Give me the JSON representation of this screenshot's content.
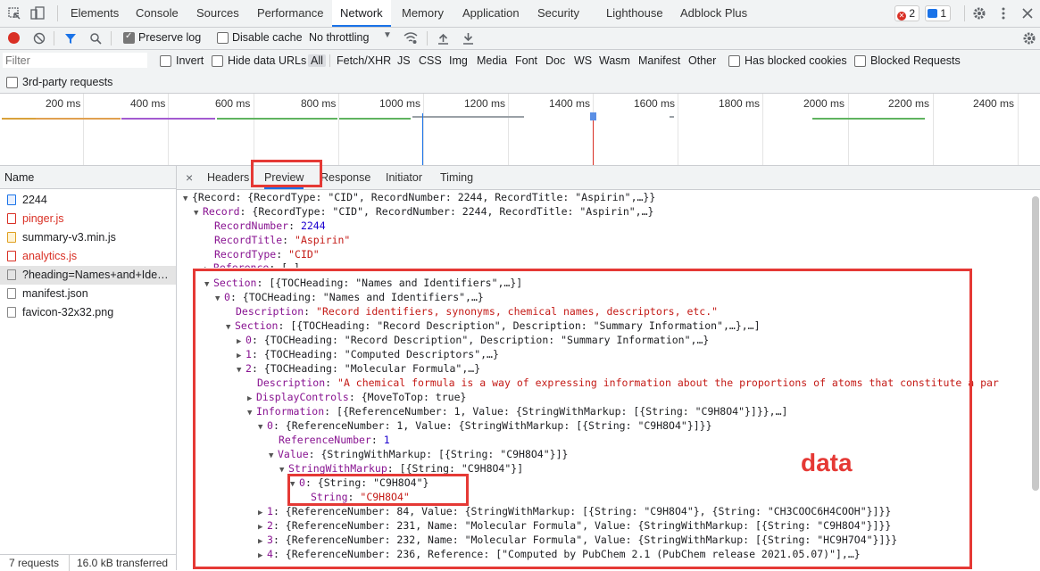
{
  "devtools_tabs": [
    "Elements",
    "Console",
    "Sources",
    "Performance",
    "Network",
    "Memory",
    "Application",
    "Security",
    "Lighthouse",
    "Adblock Plus"
  ],
  "active_tab": "Network",
  "badges": {
    "errors": "2",
    "messages": "1"
  },
  "toolbar": {
    "preserve_log": "Preserve log",
    "disable_cache": "Disable cache",
    "throttling": "No throttling"
  },
  "filter": {
    "placeholder": "Filter",
    "invert": "Invert",
    "hide_data_urls": "Hide data URLs",
    "types": [
      "All",
      "Fetch/XHR",
      "JS",
      "CSS",
      "Img",
      "Media",
      "Font",
      "Doc",
      "WS",
      "Wasm",
      "Manifest",
      "Other"
    ],
    "has_blocked_cookies": "Has blocked cookies",
    "blocked_requests": "Blocked Requests",
    "third_party": "3rd-party requests"
  },
  "timeline_ticks": [
    "200 ms",
    "400 ms",
    "600 ms",
    "800 ms",
    "1000 ms",
    "1200 ms",
    "1400 ms",
    "1600 ms",
    "1800 ms",
    "2000 ms",
    "2200 ms",
    "2400 ms"
  ],
  "name_header": "Name",
  "requests": [
    {
      "name": "2244",
      "red": false,
      "selected": false
    },
    {
      "name": "pinger.js",
      "red": true,
      "selected": false
    },
    {
      "name": "summary-v3.min.js",
      "red": false,
      "selected": false
    },
    {
      "name": "analytics.js",
      "red": true,
      "selected": false
    },
    {
      "name": "?heading=Names+and+Identifiers",
      "red": false,
      "selected": true
    },
    {
      "name": "manifest.json",
      "red": false,
      "selected": false
    },
    {
      "name": "favicon-32x32.png",
      "red": false,
      "selected": false
    }
  ],
  "status": {
    "requests": "7 requests",
    "transferred": "16.0 kB transferred"
  },
  "detail_tabs": [
    "Headers",
    "Preview",
    "Response",
    "Initiator",
    "Timing"
  ],
  "detail_active": "Preview",
  "annotation": "data",
  "preview": {
    "root": "{Record: {RecordType: \"CID\", RecordNumber: 2244, RecordTitle: \"Aspirin\",…}}",
    "record_summary": "{RecordType: \"CID\", RecordNumber: 2244, RecordTitle: \"Aspirin\",…}",
    "record_number": "2244",
    "record_title": "\"Aspirin\"",
    "record_type": "\"CID\"",
    "reference": "[…]",
    "section": "[{TOCHeading: \"Names and Identifiers\",…}]",
    "sec0": "{TOCHeading: \"Names and Identifiers\",…}",
    "sec0_desc": "\"Record identifiers, synonyms, chemical names, descriptors, etc.\"",
    "sec0_section": "[{TOCHeading: \"Record Description\", Description: \"Summary Information\",…},…]",
    "s0": "{TOCHeading: \"Record Description\", Description: \"Summary Information\",…}",
    "s1": "{TOCHeading: \"Computed Descriptors\",…}",
    "s2": "{TOCHeading: \"Molecular Formula\",…}",
    "s2_desc": "\"A chemical formula is a way of expressing information about the proportions of atoms that constitute a par",
    "display_controls": "{MoveToTop: true}",
    "information": "[{ReferenceNumber: 1, Value: {StringWithMarkup: [{String: \"C9H8O4\"}]}},…]",
    "i0": "{ReferenceNumber: 1, Value: {StringWithMarkup: [{String: \"C9H8O4\"}]}}",
    "i0_ref": "1",
    "i0_value": "{StringWithMarkup: [{String: \"C9H8O4\"}]}",
    "swm": "[{String: \"C9H8O4\"}]",
    "swm0": "{String: \"C9H8O4\"}",
    "swm0_string": "\"C9H8O4\"",
    "i1": "{ReferenceNumber: 84, Value: {StringWithMarkup: [{String: \"C9H8O4\"}, {String: \"CH3COOC6H4COOH\"}]}}",
    "i2": "{ReferenceNumber: 231, Name: \"Molecular Formula\", Value: {StringWithMarkup: [{String: \"C9H8O4\"}]}}",
    "i3": "{ReferenceNumber: 232, Name: \"Molecular Formula\", Value: {StringWithMarkup: [{String: \"HC9H7O4\"}]}}",
    "i4": "{ReferenceNumber: 236, Reference: [\"Computed by PubChem 2.1 (PubChem release 2021.05.07)\"],…}"
  }
}
